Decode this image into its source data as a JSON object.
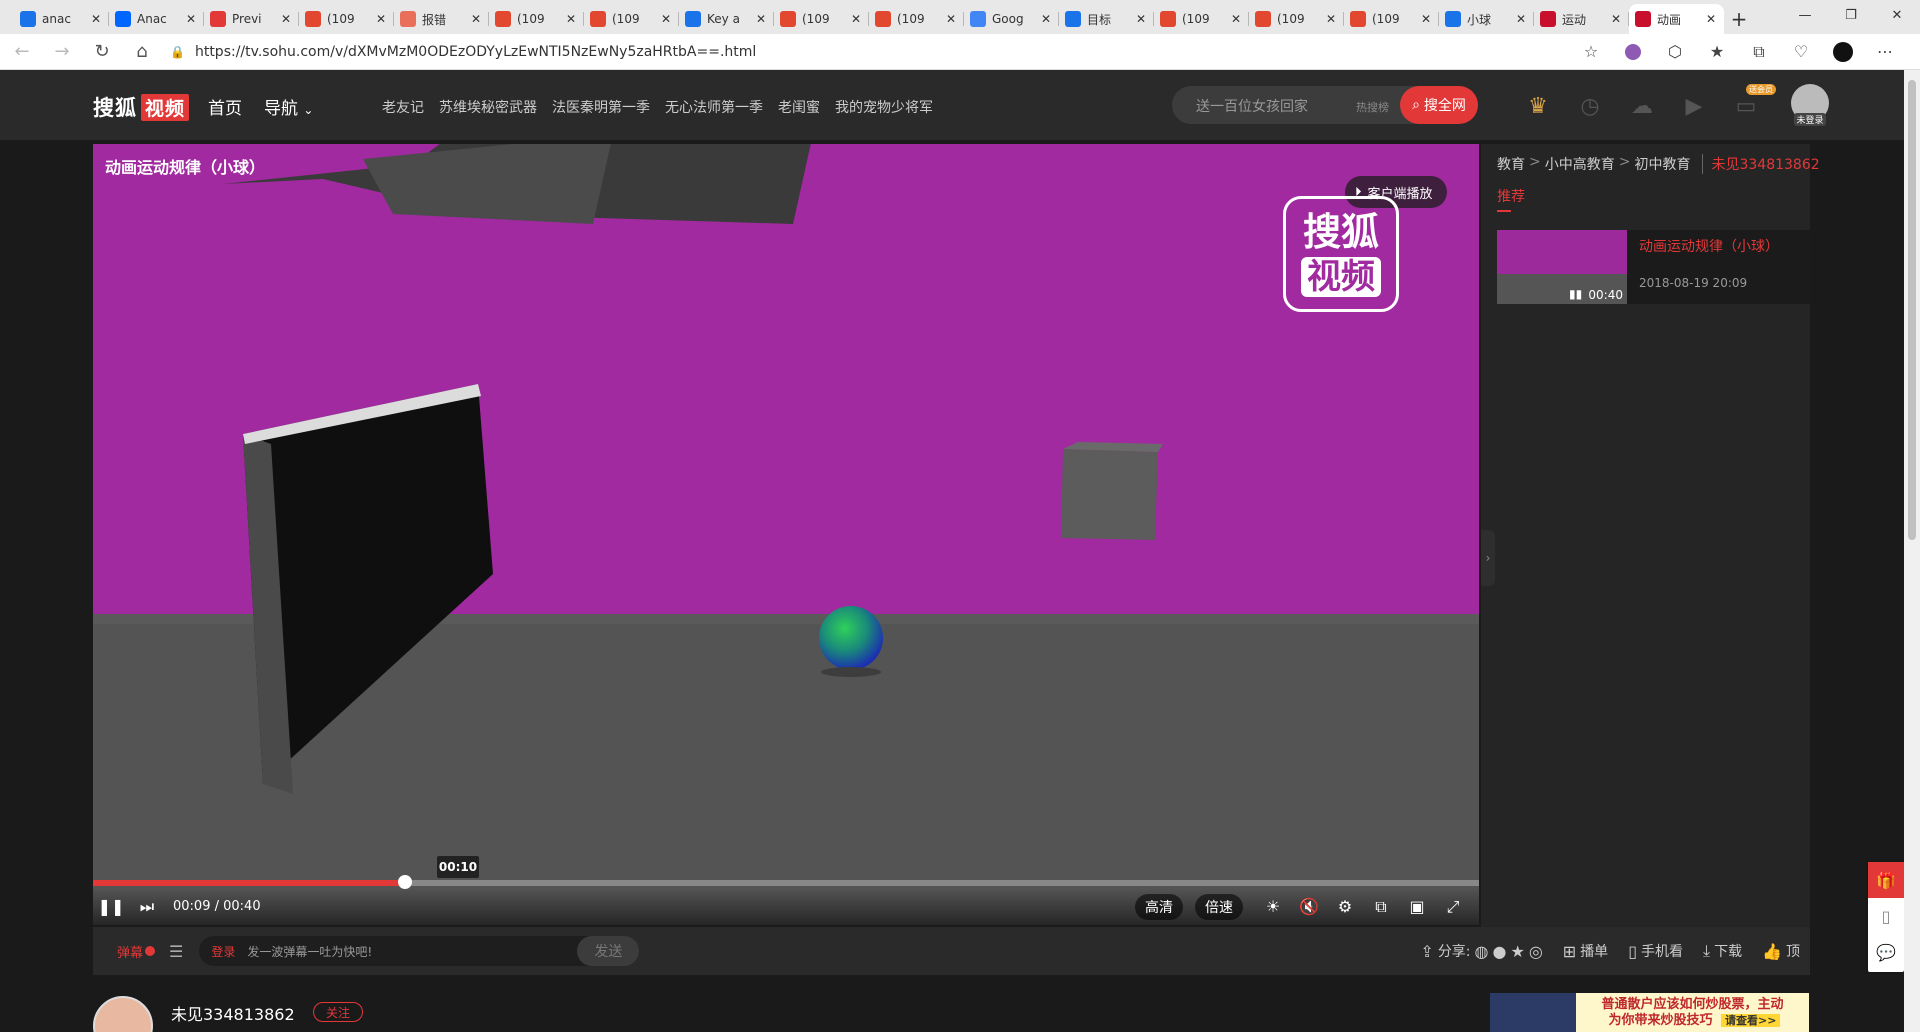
{
  "browser": {
    "tabs": [
      {
        "label": "anac",
        "icon": "bing-icon",
        "color": "#1a73e8"
      },
      {
        "label": "Anac",
        "icon": "zhihu-icon",
        "color": "#0066ff"
      },
      {
        "label": "Previ",
        "icon": "opera-icon",
        "color": "#e23838"
      },
      {
        "label": "(109",
        "icon": "csdn-icon",
        "color": "#e2472f"
      },
      {
        "label": "报错",
        "icon": "jianshu-icon",
        "color": "#ea6f5a"
      },
      {
        "label": "(109",
        "icon": "csdn-icon",
        "color": "#e2472f"
      },
      {
        "label": "(109",
        "icon": "csdn-icon",
        "color": "#e2472f"
      },
      {
        "label": "Key a",
        "icon": "bing-icon",
        "color": "#1a73e8"
      },
      {
        "label": "(109",
        "icon": "csdn-icon",
        "color": "#e2472f"
      },
      {
        "label": "(109",
        "icon": "csdn-icon",
        "color": "#e2472f"
      },
      {
        "label": "Goog",
        "icon": "google-translate-icon",
        "color": "#4285f4"
      },
      {
        "label": "目标",
        "icon": "bing-icon",
        "color": "#1a73e8"
      },
      {
        "label": "(109",
        "icon": "csdn-icon",
        "color": "#e2472f"
      },
      {
        "label": "(109",
        "icon": "csdn-icon",
        "color": "#e2472f"
      },
      {
        "label": "(109",
        "icon": "csdn-icon",
        "color": "#e2472f"
      },
      {
        "label": "小球",
        "icon": "bing-icon",
        "color": "#1a73e8"
      },
      {
        "label": "运动",
        "icon": "sohu-video-icon",
        "color": "#c8102e"
      },
      {
        "label": "动画",
        "icon": "sohu-video-icon",
        "color": "#c8102e",
        "active": true
      }
    ],
    "url": "https://tv.sohu.com/v/dXMvMzM0ODEzODYyLzEwNTI5NzEwNy5zaHRtbA==.html"
  },
  "header": {
    "logo_text": "搜狐",
    "logo_badge": "视频",
    "nav": [
      "首页",
      "导航"
    ],
    "hotlinks": [
      "老友记",
      "苏维埃秘密武器",
      "法医秦明第一季",
      "无心法师第一季",
      "老闺蜜",
      "我的宠物少将军"
    ],
    "search_placeholder": "送一百位女孩回家",
    "search_hot": "热搜榜",
    "search_button": "搜全网",
    "vip_badge": "送会员",
    "login_label": "未登录"
  },
  "video": {
    "title": "动画运动规律（小球）",
    "client_play": "客户端播放",
    "watermark_top": "搜狐",
    "watermark_bottom": "视频",
    "hover_time": "00:10",
    "current": "00:09",
    "duration": "00:40",
    "progress_fraction": 0.225,
    "quality": "高清",
    "speed": "倍速"
  },
  "sidebar": {
    "breadcrumb": [
      "教育",
      "小中高教育",
      "初中教育"
    ],
    "uploader": "未见334813862",
    "tab": "推荐",
    "recommend": [
      {
        "title": "动画运动规律（小球）",
        "date": "2018-08-19 20:09",
        "duration": "00:40"
      }
    ]
  },
  "danmaku": {
    "toggle": "弹幕",
    "login": "登录",
    "placeholder": "发一波弹幕一吐为快吧!",
    "send": "发送"
  },
  "actions": {
    "share": "分享:",
    "playlist": "播单",
    "mobile": "手机看",
    "download": "下载",
    "like": "顶"
  },
  "uploader": {
    "name": "未见334813862",
    "follow": "关注"
  },
  "ad": {
    "line1": "普通散户应该如何炒股票，主动",
    "line2": "为你带来炒股技巧",
    "cta": "请查看>>"
  }
}
